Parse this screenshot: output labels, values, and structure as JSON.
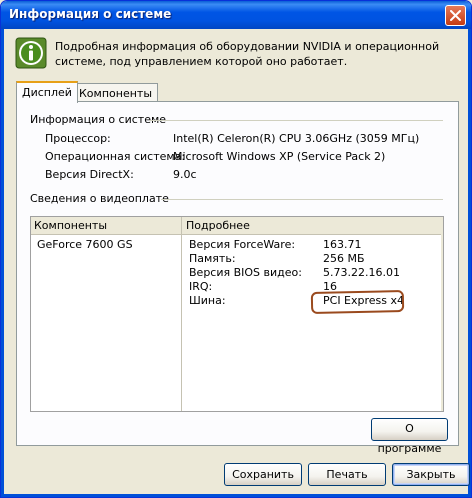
{
  "window": {
    "title": "Информация о системе"
  },
  "intro": {
    "text": "Подробная информация об оборудовании NVIDIA и операционной системе, под управлением которой оно работает.",
    "icon": "info-icon"
  },
  "tabs": [
    {
      "label": "Дисплей",
      "active": true
    },
    {
      "label": "Компоненты",
      "active": false
    }
  ],
  "system_info": {
    "title": "Информация о системе",
    "rows": [
      {
        "label": "Процессор:",
        "value": "Intel(R) Celeron(R) CPU 3.06GHz (3059 МГц)"
      },
      {
        "label": "Операционная система:",
        "value": "Microsoft Windows XP (Service Pack 2)"
      },
      {
        "label": "Версия DirectX:",
        "value": "9.0c"
      }
    ]
  },
  "video_info": {
    "title": "Сведения о видеоплате",
    "columns": [
      "Компоненты",
      "Подробнее"
    ],
    "component": "GeForce 7600 GS",
    "details": [
      {
        "label": "Версия ForceWare:",
        "value": "163.71"
      },
      {
        "label": "Память:",
        "value": "256 МБ"
      },
      {
        "label": "Версия BIOS видео:",
        "value": "5.73.22.16.01"
      },
      {
        "label": "IRQ:",
        "value": "16"
      },
      {
        "label": "Шина:",
        "value": "PCI Express x4",
        "highlighted": true
      }
    ]
  },
  "buttons": {
    "about": "О программе",
    "save": "Сохранить",
    "print": "Печать",
    "close": "Закрыть"
  },
  "colors": {
    "titlebar": "#0055e5",
    "highlight_outline": "#9a4a1e",
    "tab_accent": "#e7a017"
  }
}
